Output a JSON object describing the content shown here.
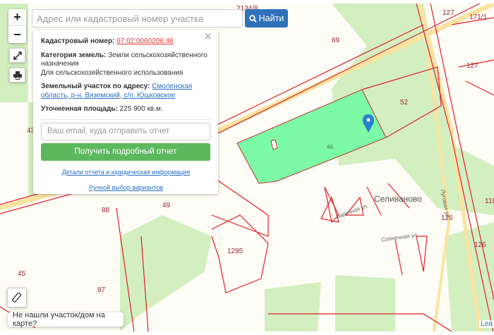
{
  "search": {
    "placeholder": "Адрес или кадастровый номер участка",
    "button_label": "Найти"
  },
  "controls": {
    "zoom_in": "+",
    "zoom_out": "−"
  },
  "popup": {
    "cadastral_label": "Кадастровый номер:",
    "cadastral_value": "67:02:0060206:46",
    "category_label": "Категория земель:",
    "category_value": "Земли сельскохозяйственного назначения",
    "usage": "Для сельскохозяйственного использования",
    "address_label": "Земельный участок по адресу:",
    "address_value": "Смоленская область, р-н. Вяземский, с/п. Юшковское",
    "area_label": "Уточненная площадь:",
    "area_value": "225 900 кв.м.",
    "email_placeholder": "Ваш email, куда отправить отчет",
    "report_button": "Получить подробный отчет",
    "details_link": "Детали отчета и юридическая информация",
    "manual_link": "Ручной выбор вариантов",
    "close": "✕"
  },
  "hint": "Не нашли участок/дом на карте?",
  "attribution": "Lea",
  "map_labels": {
    "l2134": "2134/8",
    "l69": "69",
    "l127a": "127",
    "l171": "171/1",
    "l127b": "127",
    "l52": "52",
    "l46": "46",
    "l43": "43",
    "l88": "88",
    "l49": "49",
    "l1295": "1295",
    "l45": "45",
    "l87": "87",
    "l118": "118",
    "l126a": "126",
    "l126b": "126",
    "village": "Селиваново",
    "street1": "Заречная ул.",
    "street2": "Солнечная ул.",
    "street3": "Луговая ул."
  },
  "colors": {
    "parcel_selected": "#7dfaa6",
    "parcel_border": "#e0202a",
    "forest": "#d3efc0",
    "road": "#fbe3a0",
    "button_blue": "#2f72b8",
    "button_green": "#5cb85c"
  }
}
